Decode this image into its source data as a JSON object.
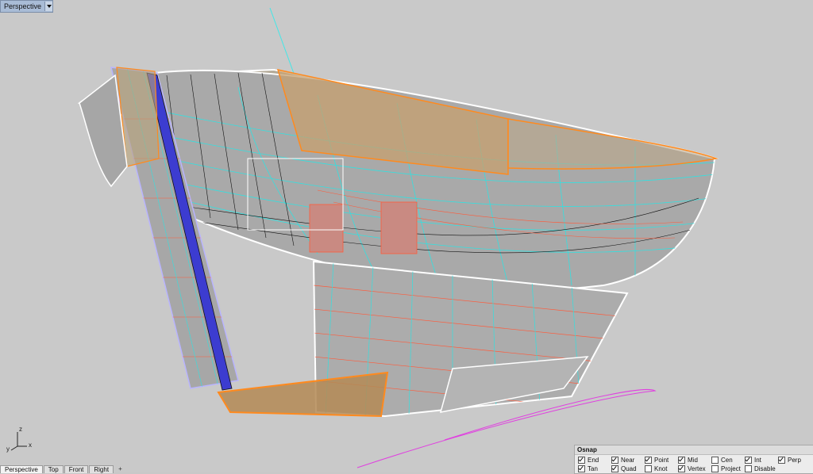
{
  "viewport": {
    "title": "Perspective",
    "axis_x": "x",
    "axis_y": "y",
    "axis_z": "z"
  },
  "tabs": [
    {
      "label": "Perspective"
    },
    {
      "label": "Top"
    },
    {
      "label": "Front"
    },
    {
      "label": "Right"
    }
  ],
  "tab_add": "+",
  "osnap": {
    "title": "Osnap",
    "options": [
      {
        "label": "End",
        "checked": true
      },
      {
        "label": "Near",
        "checked": true
      },
      {
        "label": "Point",
        "checked": true
      },
      {
        "label": "Mid",
        "checked": true
      },
      {
        "label": "Cen",
        "checked": false
      },
      {
        "label": "Int",
        "checked": true
      },
      {
        "label": "Perp",
        "checked": true
      },
      {
        "label": "Tan",
        "checked": true
      },
      {
        "label": "Quad",
        "checked": true
      },
      {
        "label": "Knot",
        "checked": false
      },
      {
        "label": "Vertex",
        "checked": true
      },
      {
        "label": "Project",
        "checked": false
      },
      {
        "label": "Disable",
        "checked": false
      }
    ]
  },
  "colors": {
    "background": "#c9c9c9",
    "selection_orange": "#ff8a1e",
    "wire_cyan": "#33e0e0",
    "wire_red": "#ff5a3a",
    "wire_blue": "#2233cc",
    "wire_magenta": "#e040e0"
  }
}
